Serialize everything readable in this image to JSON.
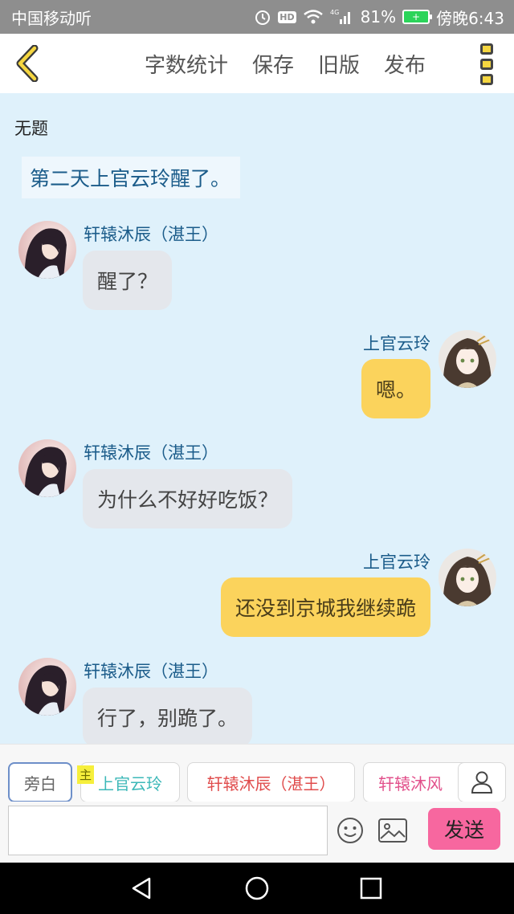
{
  "status_bar": {
    "carrier": "中国移动听",
    "network": "4G",
    "battery": "81%",
    "time": "傍晚6:43",
    "hd": "HD"
  },
  "toolbar": {
    "word_count": "字数统计",
    "save": "保存",
    "old_version": "旧版",
    "publish": "发布"
  },
  "chat": {
    "title": "无题",
    "narration": "第二天上官云玲醒了。",
    "messages": [
      {
        "speaker": "轩辕沐辰（湛王）",
        "text": "醒了？",
        "side": "left"
      },
      {
        "speaker": "上官云玲",
        "text": "嗯。",
        "side": "right"
      },
      {
        "speaker": "轩辕沐辰（湛王）",
        "text": "为什么不好好吃饭？",
        "side": "left"
      },
      {
        "speaker": "上官云玲",
        "text": "还没到京城我继续跪",
        "side": "right"
      },
      {
        "speaker": "轩辕沐辰（湛王）",
        "text": "行了，别跪了。",
        "side": "left"
      }
    ]
  },
  "selector": {
    "narrator": "旁白",
    "main_badge": "主",
    "characters": [
      "上官云玲",
      "轩辕沐辰（湛王）",
      "轩辕沐风"
    ]
  },
  "input": {
    "value": "",
    "placeholder": "",
    "send": "发送"
  },
  "colors": {
    "chat_bg": "#dff1fb",
    "left_bubble": "#e4e7ec",
    "right_bubble": "#fbd35c",
    "send_button": "#f7679f",
    "name_color": "#1b5c8a"
  }
}
